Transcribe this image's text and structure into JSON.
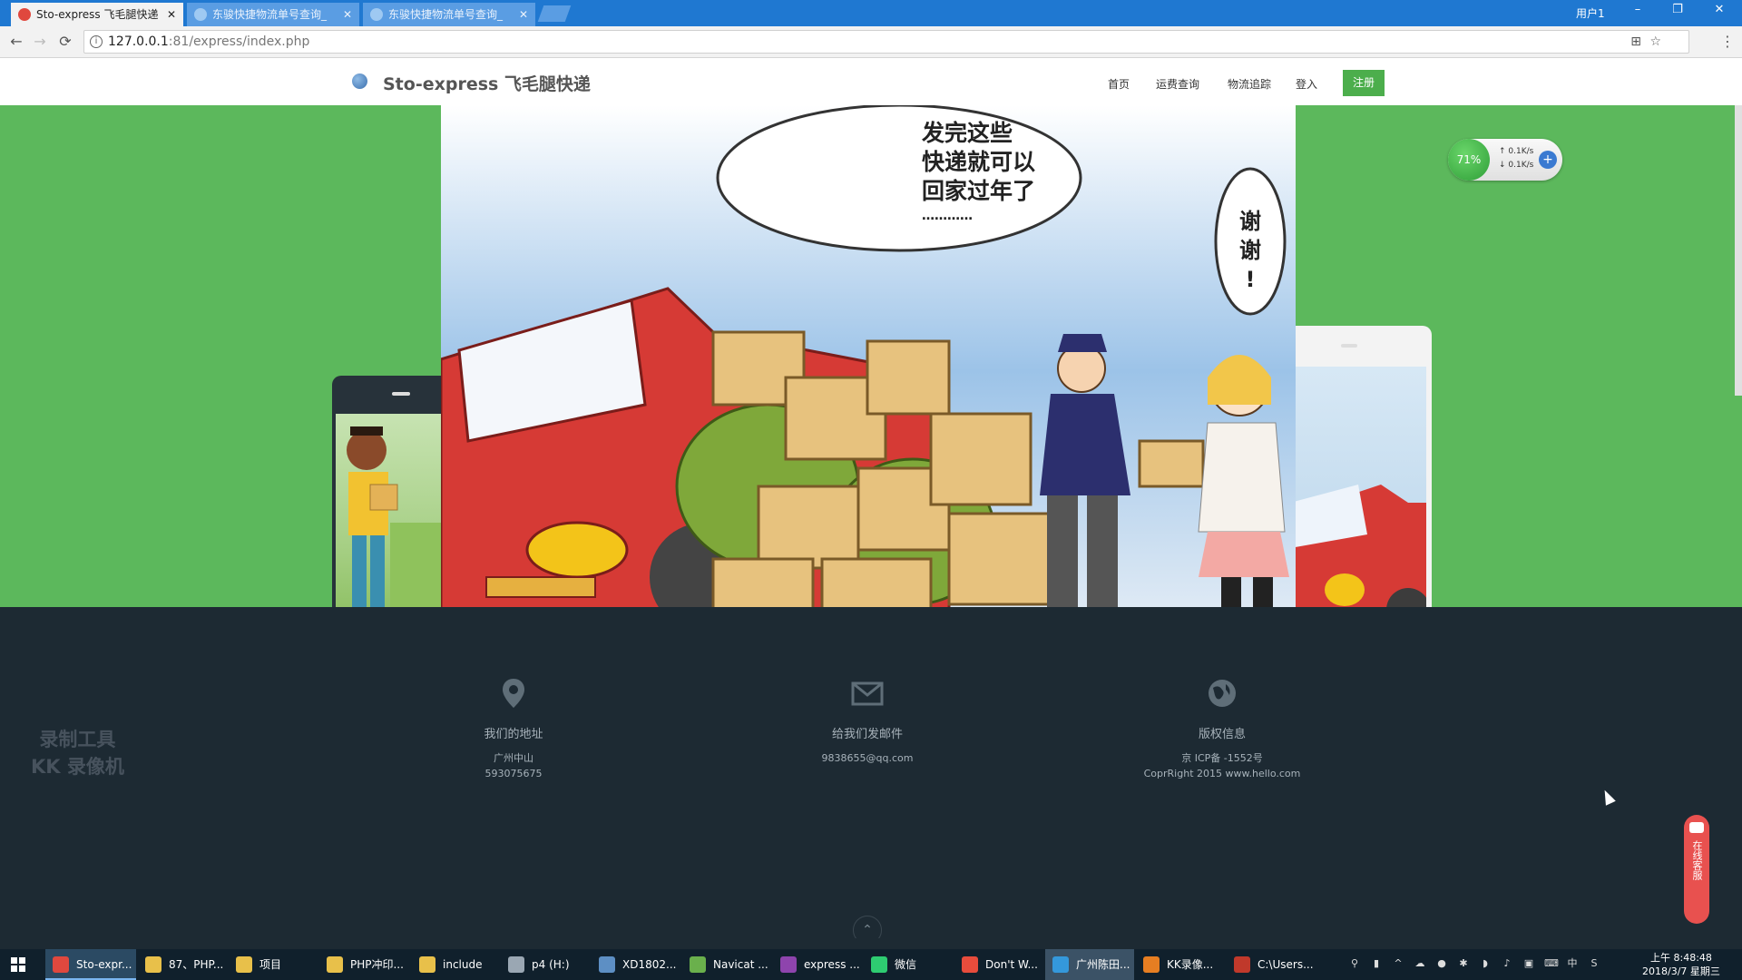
{
  "browser": {
    "tabs": [
      {
        "title": "Sto-express 飞毛腿快递",
        "active": true
      },
      {
        "title": "东骏快捷物流单号查询_",
        "active": false
      },
      {
        "title": "东骏快捷物流单号查询_",
        "active": false
      }
    ],
    "user_label": "用户1",
    "window_buttons": {
      "minimize": "–",
      "restore": "❐",
      "close": "✕"
    },
    "url": {
      "host": "127.0.0.1",
      "rest": ":81/express/index.php"
    },
    "nav": {
      "back": "←",
      "forward": "→",
      "reload": "⟳"
    },
    "omni_icons": {
      "translate": "⊞",
      "bookmark": "☆",
      "menu": "⋮"
    },
    "info_icon": "i"
  },
  "site": {
    "brand": "Sto-express 飞毛腿快递",
    "nav_links": [
      "首页",
      "运费查询",
      "物流追踪",
      "登入"
    ],
    "register_label": "注册"
  },
  "hero": {
    "bubble_text": [
      "发完这些",
      "快递就可以",
      "回家过年了",
      "…………"
    ],
    "thanks_text": [
      "谢",
      "谢",
      "!"
    ]
  },
  "footer": {
    "columns": [
      {
        "icon": "map-marker-icon",
        "title": "我们的地址",
        "lines": [
          "广州中山",
          "593075675"
        ]
      },
      {
        "icon": "envelope-icon",
        "title": "给我们发邮件",
        "lines": [
          "9838655@qq.com"
        ]
      },
      {
        "icon": "globe-icon",
        "title": "版权信息",
        "lines": [
          "京 ICP备 -1552号",
          "CoprRight 2015 www.hello.com"
        ]
      }
    ],
    "to_top": "⌃"
  },
  "watermark": [
    "录制工具",
    "KK 录像机"
  ],
  "netspeed": {
    "percent": "71%",
    "up": "0.1K/s",
    "down": "0.1K/s",
    "up_arrow": "↑",
    "down_arrow": "↓",
    "plus": "+"
  },
  "chat_widget": {
    "label": "在线客服"
  },
  "taskbar": {
    "items": [
      {
        "label": "Sto-expr...",
        "color": "#e0483e",
        "state": "active"
      },
      {
        "label": "87、PHP...",
        "color": "#e8c04a",
        "state": ""
      },
      {
        "label": "项目",
        "color": "#e8c04a",
        "state": ""
      },
      {
        "label": "PHP冲印...",
        "color": "#e8c04a",
        "state": ""
      },
      {
        "label": "include",
        "color": "#e8c04a",
        "state": ""
      },
      {
        "label": "p4 (H:)",
        "color": "#9aa7b3",
        "state": ""
      },
      {
        "label": "XD1802...",
        "color": "#5d8fc4",
        "state": ""
      },
      {
        "label": "Navicat ...",
        "color": "#6ab04c",
        "state": ""
      },
      {
        "label": "express ...",
        "color": "#8e44ad",
        "state": ""
      },
      {
        "label": "微信",
        "color": "#2ecc71",
        "state": ""
      },
      {
        "label": "Don't W...",
        "color": "#e74c3c",
        "state": ""
      },
      {
        "label": "广州陈田...",
        "color": "#3498db",
        "state": "highlight"
      },
      {
        "label": "KK录像...",
        "color": "#e67e22",
        "state": ""
      },
      {
        "label": "C:\\Users...",
        "color": "#c0392b",
        "state": ""
      }
    ],
    "tray": [
      "⚲",
      "▮",
      "^",
      "☁",
      "●",
      "✱",
      "◗",
      "♪",
      "▣",
      "⌨",
      "中",
      "S"
    ],
    "clock_time": "上午 8:48:48",
    "clock_date": "2018/3/7 星期三"
  }
}
